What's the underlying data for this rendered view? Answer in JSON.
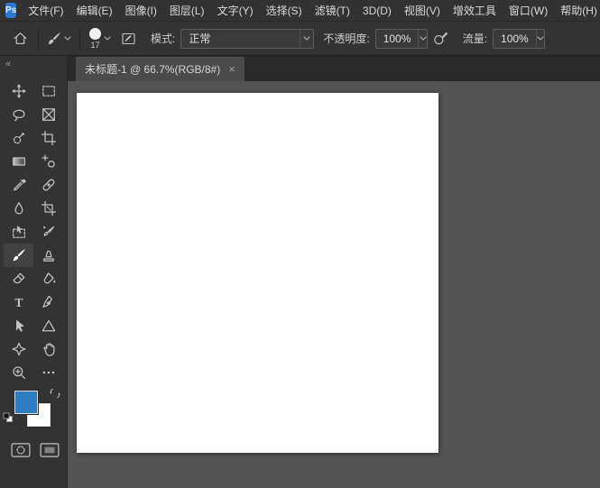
{
  "menubar": {
    "logo": "Ps",
    "items": [
      {
        "name": "file",
        "label": "文件(F)"
      },
      {
        "name": "edit",
        "label": "编辑(E)"
      },
      {
        "name": "image",
        "label": "图像(I)"
      },
      {
        "name": "layer",
        "label": "图层(L)"
      },
      {
        "name": "type",
        "label": "文字(Y)"
      },
      {
        "name": "select",
        "label": "选择(S)"
      },
      {
        "name": "filter",
        "label": "滤镜(T)"
      },
      {
        "name": "3d",
        "label": "3D(D)"
      },
      {
        "name": "view",
        "label": "视图(V)"
      },
      {
        "name": "plugins",
        "label": "增效工具"
      },
      {
        "name": "window",
        "label": "窗口(W)"
      },
      {
        "name": "help",
        "label": "帮助(H)"
      }
    ]
  },
  "options_bar": {
    "brush_size": "17",
    "mode": {
      "label": "模式:",
      "value": "正常"
    },
    "opacity": {
      "label": "不透明度:",
      "value": "100%"
    },
    "flow": {
      "label": "流量:",
      "value": "100%"
    }
  },
  "tab_bar": {
    "tabs": [
      {
        "title": "未标题-1 @ 66.7%(RGB/8#)",
        "close": "×",
        "active": true
      }
    ]
  },
  "toolbar": {
    "collapse_glyph": "«",
    "foreground_color": "#2E7BC1",
    "background_color": "#FFFFFF",
    "tools": [
      {
        "name": "move"
      },
      {
        "name": "rectangular-marquee"
      },
      {
        "name": "lasso"
      },
      {
        "name": "frame"
      },
      {
        "name": "quick-selection"
      },
      {
        "name": "crop"
      },
      {
        "name": "gradient"
      },
      {
        "name": "count"
      },
      {
        "name": "eyedropper"
      },
      {
        "name": "spot-healing-brush"
      },
      {
        "name": "blur"
      },
      {
        "name": "perspective-crop"
      },
      {
        "name": "object-selection"
      },
      {
        "name": "mixer-brush"
      },
      {
        "name": "brush",
        "active": true
      },
      {
        "name": "clone-stamp"
      },
      {
        "name": "eraser"
      },
      {
        "name": "paint-bucket"
      },
      {
        "name": "type"
      },
      {
        "name": "pen"
      },
      {
        "name": "path-selection"
      },
      {
        "name": "triangle-shape"
      },
      {
        "name": "custom-shape"
      },
      {
        "name": "hand"
      },
      {
        "name": "zoom"
      },
      {
        "name": "more-tools"
      }
    ]
  }
}
